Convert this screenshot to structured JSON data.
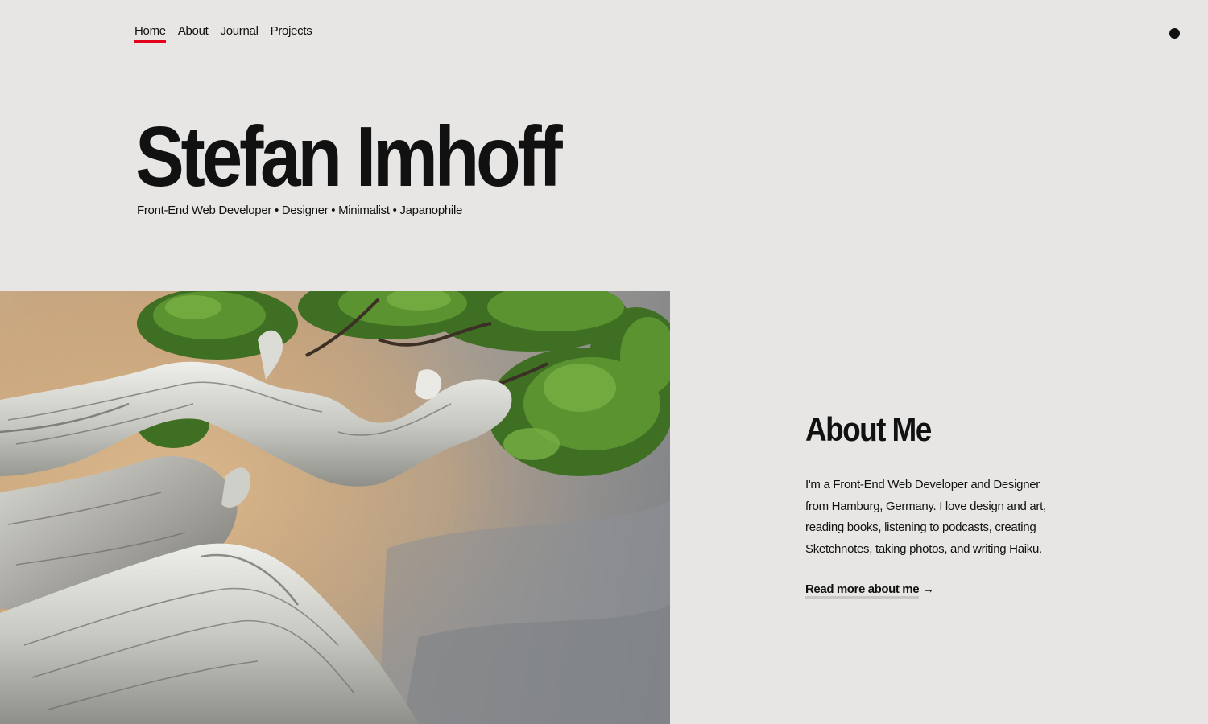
{
  "nav": {
    "items": [
      {
        "label": "Home",
        "active": true
      },
      {
        "label": "About",
        "active": false
      },
      {
        "label": "Journal",
        "active": false
      },
      {
        "label": "Projects",
        "active": false
      }
    ],
    "active_color": "#e3001b"
  },
  "hero": {
    "title": "Stefan Imhoff",
    "subtitle": "Front-End Web Developer • Designer • Minimalist • Japanophile"
  },
  "photo": {
    "subject": "bonsai-driftwood-photo"
  },
  "about": {
    "heading": "About Me",
    "body": "I'm a Front-End Web Developer and Designer from Hamburg, Germany. I love design and art, reading books, listening to podcasts, creating Sketchnotes, taking photos, and writing Haiku.",
    "link_label": "Read more about me",
    "link_icon": "arrow-right-icon",
    "link_arrow": "→"
  },
  "colors": {
    "background": "#e7e6e4",
    "text": "#111111",
    "accent": "#e3001b"
  }
}
